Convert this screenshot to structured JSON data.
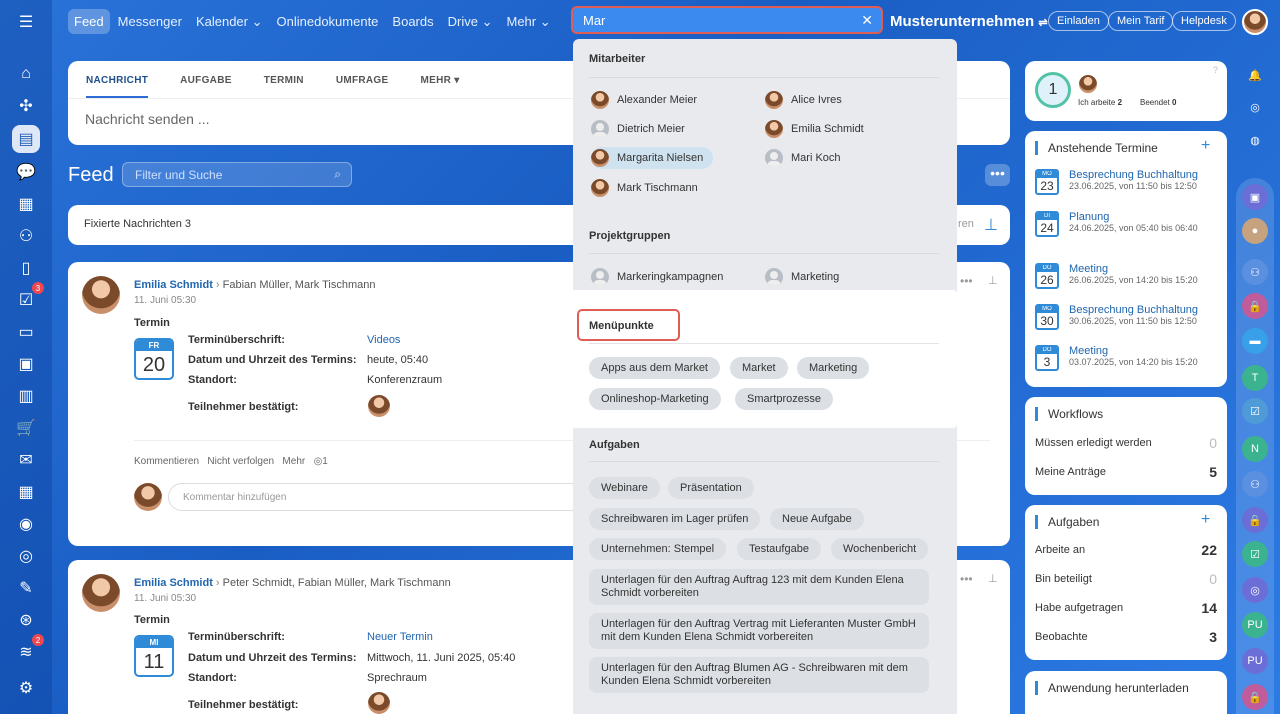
{
  "topnav": {
    "items": [
      "Feed",
      "Messenger",
      "Kalender",
      "Onlinedokumente",
      "Boards",
      "Drive",
      "Mehr"
    ]
  },
  "search": {
    "value": "Mar"
  },
  "org": "Musterunternehmen",
  "header_buttons": [
    "Einladen",
    "Mein Tarif",
    "Helpdesk"
  ],
  "composer": {
    "tabs": [
      "NACHRICHT",
      "AUFGABE",
      "TERMIN",
      "UMFRAGE",
      "MEHR"
    ],
    "placeholder": "Nachricht senden ..."
  },
  "feed": {
    "title": "Feed",
    "filter_placeholder": "Filter und Suche",
    "pinned": "Fixierte Nachrichten",
    "pinned_count": "3",
    "pinned_right": "ren"
  },
  "posts": [
    {
      "author": "Emilia Schmidt",
      "recipients": "Fabian Müller, Mark Tischmann",
      "date": "11. Juni 05:30",
      "type": "Termin",
      "cal_month": "FR",
      "cal_day": "20",
      "l1": "Terminüberschrift:",
      "v1": "Videos",
      "l2": "Datum und Uhrzeit des Termins:",
      "v2": "heute, 05:40",
      "l3": "Standort:",
      "v3": "Konferenzraum",
      "l4": "Teilnehmer bestätigt:",
      "actions": [
        "Kommentieren",
        "Nicht verfolgen",
        "Mehr"
      ],
      "views": "1",
      "comment_placeholder": "Kommentar hinzufügen"
    },
    {
      "author": "Emilia Schmidt",
      "recipients": "Peter Schmidt, Fabian Müller, Mark Tischmann",
      "date": "11. Juni 05:30",
      "type": "Termin",
      "cal_month": "MI",
      "cal_day": "11",
      "l1": "Terminüberschrift:",
      "v1": "Neuer Termin",
      "l2": "Datum und Uhrzeit des Termins:",
      "v2": "Mittwoch, 11. Juni 2025, 05:40",
      "l3": "Standort:",
      "v3": "Sprechraum",
      "l4": "Teilnehmer bestätigt:"
    }
  ],
  "dropdown": {
    "sec_people": "Mitarbeiter",
    "people": [
      "Alexander Meier",
      "Alice Ivres",
      "Dietrich Meier",
      "Emilia Schmidt",
      "Margarita Nielsen",
      "Mari Koch",
      "Mark Tischmann"
    ],
    "sec_groups": "Projektgruppen",
    "groups": [
      "Markeringkampagnen",
      "Marketing"
    ],
    "sec_menu": "Menüpunkte",
    "menu": [
      "Apps aus dem Market",
      "Market",
      "Marketing",
      "Onlineshop-Marketing",
      "Smartprozesse"
    ],
    "sec_tasks": "Aufgaben",
    "tasks": [
      "Webinare",
      "Präsentation",
      "Schreibwaren im Lager prüfen",
      "Neue Aufgabe",
      "Unternehmen: Stempel",
      "Testaufgabe",
      "Wochenbericht",
      "Unterlagen für den Auftrag Auftrag 123 mit dem Kunden Elena Schmidt vorbereiten",
      "Unterlagen für den Auftrag Vertrag mit Lieferanten Muster GmbH mit dem Kunden Elena Schmidt vorbereiten",
      "Unterlagen für den Auftrag Blumen AG - Schreibwaren mit dem Kunden Elena Schmidt vorbereiten"
    ]
  },
  "work": {
    "count": "1",
    "working_label": "Ich arbeite",
    "working": "2",
    "done_label": "Beendet",
    "done": "0"
  },
  "events": {
    "title": "Anstehende Termine",
    "items": [
      {
        "m": "MO",
        "d": "23",
        "t": "Besprechung Buchhaltung",
        "s": "23.06.2025, von 11:50 bis 12:50"
      },
      {
        "m": "DI",
        "d": "24",
        "t": "Planung",
        "s": "24.06.2025, von 05:40 bis 06:40"
      },
      {
        "m": "DO",
        "d": "26",
        "t": "Meeting",
        "s": "26.06.2025, von 14:20 bis 15:20"
      },
      {
        "m": "MO",
        "d": "30",
        "t": "Besprechung Buchhaltung",
        "s": "30.06.2025, von 11:50 bis 12:50"
      },
      {
        "m": "DO",
        "d": "3",
        "t": "Meeting",
        "s": "03.07.2025, von 14:20 bis 15:20"
      }
    ]
  },
  "workflows": {
    "title": "Workflows",
    "r1": "Müssen erledigt werden",
    "v1": "0",
    "r2": "Meine Anträge",
    "v2": "5"
  },
  "tasks_panel": {
    "title": "Aufgaben",
    "r1": "Arbeite an",
    "v1": "22",
    "r2": "Bin beteiligt",
    "v2": "0",
    "r3": "Habe aufgetragen",
    "v3": "14",
    "r4": "Beobachte",
    "v4": "3"
  },
  "download": {
    "title": "Anwendung herunterladen"
  },
  "badges": {
    "tasks": "3",
    "feed": "2"
  },
  "rbar_letters": [
    "T",
    "N",
    "PU",
    "PU"
  ]
}
